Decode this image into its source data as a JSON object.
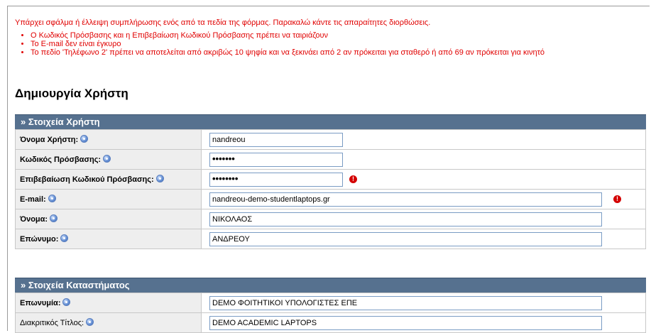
{
  "errors": {
    "message": "Υπάρχει σφάλμα ή έλλειψη συμπλήρωσης ενός από τα πεδία της φόρμας. Παρακαλώ κάντε τις απαραίτητες διορθώσεις.",
    "items": [
      "Ο Κωδικός Πρόσβασης και η Επιβεβαίωση Κωδικού Πρόσβασης πρέπει να ταιριάζουν",
      "Το E-mail δεν είναι έγκυρο",
      "Το πεδίο 'Τηλέφωνο 2' πρέπει να αποτελείται από ακριβώς 10 ψηφία και να ξεκινάει από 2 αν πρόκειται για σταθερό ή από 69 αν πρόκειται για κινητό"
    ]
  },
  "page": {
    "title": "Δημιουργία Χρήστη"
  },
  "user_section": {
    "header": "» Στοιχεία Χρήστη",
    "username": {
      "label": "Όνομα Χρήστη:",
      "value": "nandreou"
    },
    "password": {
      "label": "Κωδικός Πρόσβασης:",
      "value": "•••••••"
    },
    "password_confirm": {
      "label": "Επιβεβαίωση Κωδικού Πρόσβασης:",
      "value": "••••••••"
    },
    "email": {
      "label": "E-mail:",
      "value": "nandreou-demo-studentlaptops.gr"
    },
    "first_name": {
      "label": "Όνομα:",
      "value": "ΝΙΚΟΛΑΟΣ"
    },
    "last_name": {
      "label": "Επώνυμο:",
      "value": "ΑΝΔΡΕΟΥ"
    }
  },
  "store_section": {
    "header": "» Στοιχεία Καταστήματος",
    "company_name": {
      "label": "Επωνυμία:",
      "value": "DEMO ΦΟΙΤΗΤΙΚΟΙ ΥΠΟΛΟΓΙΣΤΕΣ ΕΠΕ"
    },
    "trade_name": {
      "label": "Διακριτικός Τίτλος:",
      "value": "DEMO ACADEMIC LAPTOPS"
    }
  },
  "icons": {
    "help": "help-info-icon",
    "error": "error-exclamation-icon"
  },
  "colors": {
    "error_text": "#e00000",
    "section_header": "#56718f",
    "label_bg": "#eeeeee"
  }
}
